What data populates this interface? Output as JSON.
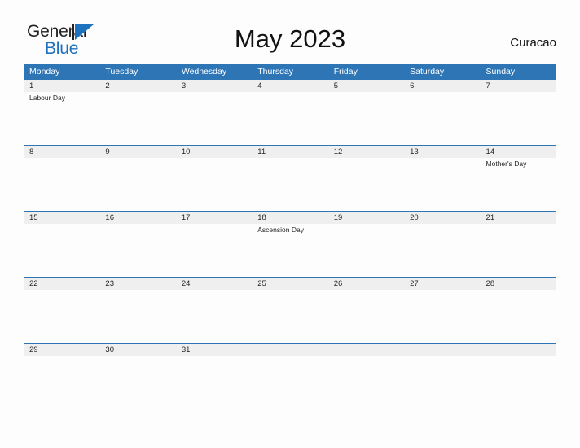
{
  "brand": {
    "word_one": "General",
    "word_two": "Blue",
    "flag_icon": "blue-triangle-flag-icon",
    "accent_color": "#1f72bd"
  },
  "header": {
    "title": "May 2023",
    "region": "Curacao"
  },
  "calendar": {
    "header_bg": "#2e75b6",
    "daynum_band_bg": "#efefef",
    "weekdays": [
      "Monday",
      "Tuesday",
      "Wednesday",
      "Thursday",
      "Friday",
      "Saturday",
      "Sunday"
    ],
    "weeks": [
      [
        {
          "day": "1",
          "event": "Labour Day"
        },
        {
          "day": "2",
          "event": ""
        },
        {
          "day": "3",
          "event": ""
        },
        {
          "day": "4",
          "event": ""
        },
        {
          "day": "5",
          "event": ""
        },
        {
          "day": "6",
          "event": ""
        },
        {
          "day": "7",
          "event": ""
        }
      ],
      [
        {
          "day": "8",
          "event": ""
        },
        {
          "day": "9",
          "event": ""
        },
        {
          "day": "10",
          "event": ""
        },
        {
          "day": "11",
          "event": ""
        },
        {
          "day": "12",
          "event": ""
        },
        {
          "day": "13",
          "event": ""
        },
        {
          "day": "14",
          "event": "Mother's Day"
        }
      ],
      [
        {
          "day": "15",
          "event": ""
        },
        {
          "day": "16",
          "event": ""
        },
        {
          "day": "17",
          "event": ""
        },
        {
          "day": "18",
          "event": "Ascension Day"
        },
        {
          "day": "19",
          "event": ""
        },
        {
          "day": "20",
          "event": ""
        },
        {
          "day": "21",
          "event": ""
        }
      ],
      [
        {
          "day": "22",
          "event": ""
        },
        {
          "day": "23",
          "event": ""
        },
        {
          "day": "24",
          "event": ""
        },
        {
          "day": "25",
          "event": ""
        },
        {
          "day": "26",
          "event": ""
        },
        {
          "day": "27",
          "event": ""
        },
        {
          "day": "28",
          "event": ""
        }
      ],
      [
        {
          "day": "29",
          "event": ""
        },
        {
          "day": "30",
          "event": ""
        },
        {
          "day": "31",
          "event": ""
        },
        {
          "day": "",
          "event": ""
        },
        {
          "day": "",
          "event": ""
        },
        {
          "day": "",
          "event": ""
        },
        {
          "day": "",
          "event": ""
        }
      ]
    ]
  }
}
